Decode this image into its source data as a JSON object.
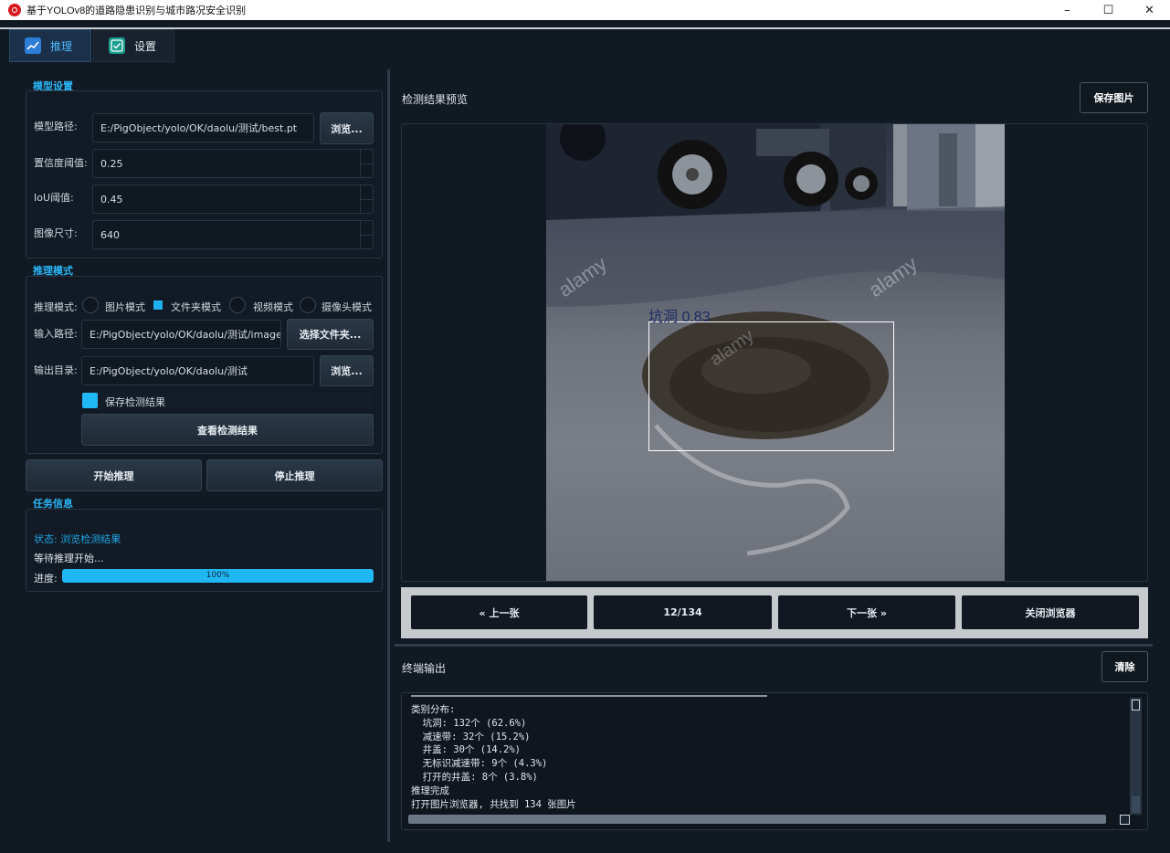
{
  "window": {
    "title": "基于YOLOv8的道路隐患识别与城市路况安全识别",
    "minimize_icon": "minimize-icon",
    "maximize_icon": "maximize-icon",
    "close_icon": "close-icon"
  },
  "tabs": [
    {
      "label": "推理",
      "icon": "line-chart-icon",
      "active": true
    },
    {
      "label": "设置",
      "icon": "checkbox-icon",
      "active": false
    }
  ],
  "model_settings": {
    "title": "模型设置",
    "model_path_label": "模型路径:",
    "model_path_value": "E:/PigObject/yolo/OK/daolu/测试/best.pt",
    "browse_label": "浏览...",
    "conf_label": "置信度阈值:",
    "conf_value": "0.25",
    "iou_label": "IoU阈值:",
    "iou_value": "0.45",
    "imgsz_label": "图像尺寸:",
    "imgsz_value": "640"
  },
  "inference_mode": {
    "title": "推理模式",
    "mode_label": "推理模式:",
    "modes": [
      {
        "label": "图片模式",
        "selected": false
      },
      {
        "label": "文件夹模式",
        "selected": true
      },
      {
        "label": "视频模式",
        "selected": false
      },
      {
        "label": "摄像头模式",
        "selected": false
      }
    ],
    "input_label": "输入路径:",
    "input_value": "E:/PigObject/yolo/OK/daolu/测试/image",
    "select_folder_label": "选择文件夹...",
    "output_label": "输出目录:",
    "output_value": "E:/PigObject/yolo/OK/daolu/测试",
    "browse_label": "浏览...",
    "save_results_label": "保存检测结果",
    "save_results_checked": true,
    "view_results_label": "查看检测结果"
  },
  "actions": {
    "start_label": "开始推理",
    "stop_label": "停止推理"
  },
  "task_info": {
    "title": "任务信息",
    "status": "状态: 浏览检测结果",
    "message": "等待推理开始...",
    "progress_label": "进度:",
    "progress_percent": 100,
    "progress_text": "100%"
  },
  "preview": {
    "title": "检测结果预览",
    "save_image_label": "保存图片",
    "detection_label": "坑洞 0.83",
    "watermark": "alamy",
    "prev_label": "« 上一张",
    "counter": "12/134",
    "next_label": "下一张 »",
    "close_label": "关闭浏览器"
  },
  "terminal": {
    "title": "终端输出",
    "clear_label": "清除",
    "lines": [
      "类别分布:",
      "  坑洞: 132个 (62.6%)",
      "  减速带: 32个 (15.2%)",
      "  井盖: 30个 (14.2%)",
      "  无标识减速带: 9个 (4.3%)",
      "  打开的井盖: 8个 (3.8%)",
      "推理完成",
      "打开图片浏览器, 共找到 134 张图片"
    ]
  },
  "colors": {
    "accent": "#1fb8f5",
    "background": "#111923",
    "detection_box": "#ffffff"
  }
}
